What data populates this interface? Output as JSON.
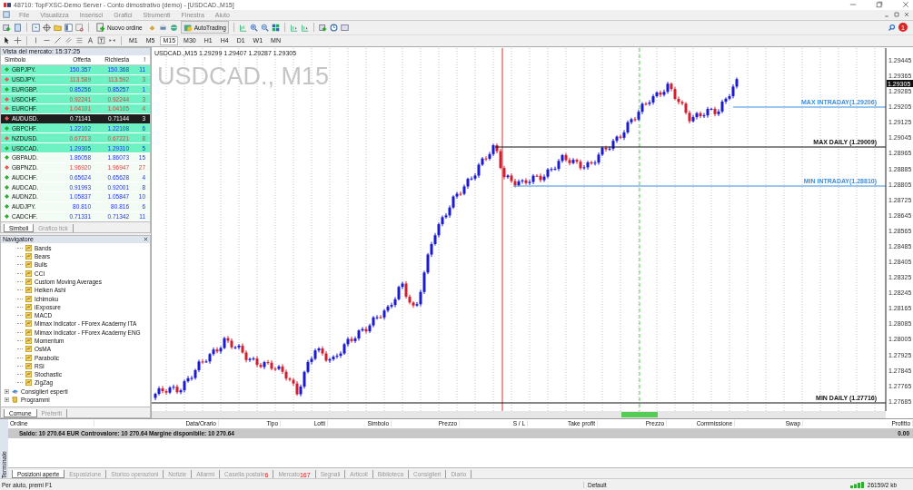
{
  "window": {
    "title": "48710: TopFXSC-Demo Server - Conto dimostrativo (demo) - [USDCAD.,M15]"
  },
  "menu": [
    "File",
    "Visualizza",
    "Inserisci",
    "Grafici",
    "Strumenti",
    "Finestra",
    "Aiuto"
  ],
  "toolbar": {
    "new_order": "Nuovo ordine",
    "autotrading": "AutoTrading",
    "notification_count": "1"
  },
  "timeframes": [
    {
      "label": "M1",
      "selected": false
    },
    {
      "label": "M5",
      "selected": false
    },
    {
      "label": "M15",
      "selected": true
    },
    {
      "label": "M30",
      "selected": false
    },
    {
      "label": "H1",
      "selected": false
    },
    {
      "label": "H4",
      "selected": false
    },
    {
      "label": "D1",
      "selected": false
    },
    {
      "label": "W1",
      "selected": false
    },
    {
      "label": "MN",
      "selected": false
    }
  ],
  "market_watch": {
    "title": "Vista del mercato: 15:37:25",
    "columns": [
      "Simbolo",
      "Offerta",
      "Richiesta",
      "!"
    ],
    "rows": [
      {
        "symbol": "GBPJPY.",
        "bid": "150.357",
        "ask": "150.368",
        "spread": "11",
        "rising": true,
        "highlighted": true,
        "selected": false
      },
      {
        "symbol": "USDJPY.",
        "bid": "113.589",
        "ask": "113.592",
        "spread": "3",
        "rising": false,
        "highlighted": true,
        "selected": false
      },
      {
        "symbol": "EURGBP.",
        "bid": "0.85256",
        "ask": "0.85257",
        "spread": "1",
        "rising": true,
        "highlighted": true,
        "selected": false
      },
      {
        "symbol": "USDCHF.",
        "bid": "0.92241",
        "ask": "0.92244",
        "spread": "3",
        "rising": false,
        "highlighted": true,
        "selected": false
      },
      {
        "symbol": "EURCHF.",
        "bid": "1.04101",
        "ask": "1.04105",
        "spread": "4",
        "rising": false,
        "highlighted": true,
        "selected": false
      },
      {
        "symbol": "AUDUSD.",
        "bid": "0.71141",
        "ask": "0.71144",
        "spread": "3",
        "rising": false,
        "highlighted": true,
        "selected": true
      },
      {
        "symbol": "GBPCHF.",
        "bid": "1.22102",
        "ask": "1.22108",
        "spread": "6",
        "rising": true,
        "highlighted": true,
        "selected": false
      },
      {
        "symbol": "NZDUSD.",
        "bid": "0.67213",
        "ask": "0.67221",
        "spread": "8",
        "rising": false,
        "highlighted": true,
        "selected": false
      },
      {
        "symbol": "USDCAD.",
        "bid": "1.29305",
        "ask": "1.29310",
        "spread": "5",
        "rising": true,
        "highlighted": true,
        "selected": false
      },
      {
        "symbol": "GBPAUD.",
        "bid": "1.86058",
        "ask": "1.86073",
        "spread": "15",
        "rising": true,
        "highlighted": false,
        "selected": false
      },
      {
        "symbol": "GBPNZD.",
        "bid": "1.96920",
        "ask": "1.96947",
        "spread": "27",
        "rising": false,
        "highlighted": false,
        "selected": false
      },
      {
        "symbol": "AUDCHF.",
        "bid": "0.65624",
        "ask": "0.65628",
        "spread": "4",
        "rising": true,
        "highlighted": false,
        "selected": false
      },
      {
        "symbol": "AUDCAD.",
        "bid": "0.91993",
        "ask": "0.92001",
        "spread": "8",
        "rising": true,
        "highlighted": false,
        "selected": false
      },
      {
        "symbol": "AUDNZD.",
        "bid": "1.05837",
        "ask": "1.05847",
        "spread": "10",
        "rising": true,
        "highlighted": false,
        "selected": false
      },
      {
        "symbol": "AUDJPY.",
        "bid": "80.810",
        "ask": "80.816",
        "spread": "6",
        "rising": true,
        "highlighted": false,
        "selected": false
      },
      {
        "symbol": "CADCHF.",
        "bid": "0.71331",
        "ask": "0.71342",
        "spread": "11",
        "rising": true,
        "highlighted": false,
        "selected": false
      }
    ],
    "tabs": [
      {
        "label": "Simboli",
        "selected": true
      },
      {
        "label": "Grafico tick",
        "selected": false
      }
    ]
  },
  "navigator": {
    "title": "Navigatore",
    "tree": [
      {
        "label": "Bands"
      },
      {
        "label": "Bears"
      },
      {
        "label": "Bulls"
      },
      {
        "label": "CCI"
      },
      {
        "label": "Custom Moving Averages"
      },
      {
        "label": "Heiken Ashi"
      },
      {
        "label": "Ichimoku"
      },
      {
        "label": "iExposure"
      },
      {
        "label": "MACD"
      },
      {
        "label": "Mimax Indicator - FForex Academy  ITA"
      },
      {
        "label": "Mimax Indicator - FForex Academy ENG"
      },
      {
        "label": "Momentum"
      },
      {
        "label": "OsMA"
      },
      {
        "label": "Parabolic"
      },
      {
        "label": "RSI"
      },
      {
        "label": "Stochastic"
      },
      {
        "label": "ZigZag"
      }
    ],
    "groups": [
      {
        "label": "Consiglieri esperti",
        "kind": "experts",
        "expanded": false
      },
      {
        "label": "Programmi",
        "kind": "scripts",
        "expanded": false
      }
    ],
    "tabs": [
      {
        "label": "Comune",
        "selected": true
      },
      {
        "label": "Preferiti",
        "selected": false
      }
    ]
  },
  "chart": {
    "title": "USDCAD., M15",
    "info": "USDCAD.,M15  1.29299 1.29407 1.29287 1.29305",
    "current_price": "1.29305",
    "price_axis": [
      "1.29445",
      "1.29365",
      "1.29285",
      "1.29205",
      "1.29125",
      "1.29045",
      "1.28965",
      "1.28885",
      "1.28805",
      "1.28725",
      "1.28645",
      "1.28565",
      "1.28485",
      "1.28405",
      "1.28325",
      "1.28245",
      "1.28165",
      "1.28085",
      "1.28005",
      "1.27925",
      "1.27845",
      "1.27765",
      "1.27685"
    ],
    "levels": [
      {
        "label": "MAX INTRADAY(1.29206)",
        "kind": "intraday"
      },
      {
        "label": "MAX DAILY (1.29009)",
        "kind": "daily"
      },
      {
        "label": "MIN INTRADAY(1.28810)",
        "kind": "intraday"
      },
      {
        "label": "MIN DAILY (1.27716)",
        "kind": "daily"
      }
    ]
  },
  "terminal": {
    "side_label": "Terminale",
    "columns": [
      "Ordine",
      "Data/Orario",
      "Tipo",
      "Lotti",
      "Simbolo",
      "Prezzo",
      "S / L",
      "Take profit",
      "Prezzo",
      "Commissione",
      "Swap",
      "Profitto"
    ],
    "balance": "Saldo: 10 270.64 EUR  Controvalore: 10 270.64  Margine disponibile: 10 270.64",
    "profit": "0.00",
    "tabs": [
      {
        "label": "Posizioni aperte",
        "selected": true
      },
      {
        "label": "Esposizione",
        "selected": false
      },
      {
        "label": "Storico operazioni",
        "selected": false
      },
      {
        "label": "Notizie",
        "selected": false
      },
      {
        "label": "Allarmi",
        "selected": false
      },
      {
        "label": "Casella postale",
        "badge": "6",
        "selected": false
      },
      {
        "label": "Mercato",
        "badge": "167",
        "selected": false
      },
      {
        "label": "Segnali",
        "selected": false
      },
      {
        "label": "Articoli",
        "selected": false
      },
      {
        "label": "Biblioteca",
        "selected": false
      },
      {
        "label": "Consiglieri",
        "selected": false
      },
      {
        "label": "Diario",
        "selected": false
      }
    ]
  },
  "status_bar": {
    "help": "Per aiuto, premi F1",
    "profile": "Default",
    "traffic": "26159/2 kb"
  }
}
